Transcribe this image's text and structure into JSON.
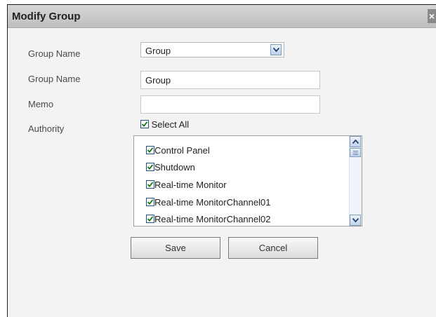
{
  "dialog": {
    "title": "Modify Group",
    "close_glyph": "×"
  },
  "form": {
    "group_select": {
      "label": "Group Name",
      "value": "Group",
      "icon": "chevron-down-icon"
    },
    "group_name": {
      "label": "Group Name",
      "value": "Group"
    },
    "memo": {
      "label": "Memo",
      "value": ""
    },
    "authority": {
      "label": "Authority",
      "select_all": {
        "label": "Select All",
        "checked": true
      },
      "items": [
        {
          "label": "Control Panel",
          "checked": true
        },
        {
          "label": "Shutdown",
          "checked": true
        },
        {
          "label": "Real-time Monitor",
          "checked": true
        },
        {
          "label": "Real-time MonitorChannel01",
          "checked": true
        },
        {
          "label": "Real-time MonitorChannel02",
          "checked": true
        }
      ]
    }
  },
  "buttons": {
    "save": "Save",
    "cancel": "Cancel"
  },
  "colors": {
    "titlebar": "#c8c8c8",
    "panel": "#f3f3f3",
    "check_mark": "#1a7a1a",
    "checkbox_border": "#1c5180"
  }
}
